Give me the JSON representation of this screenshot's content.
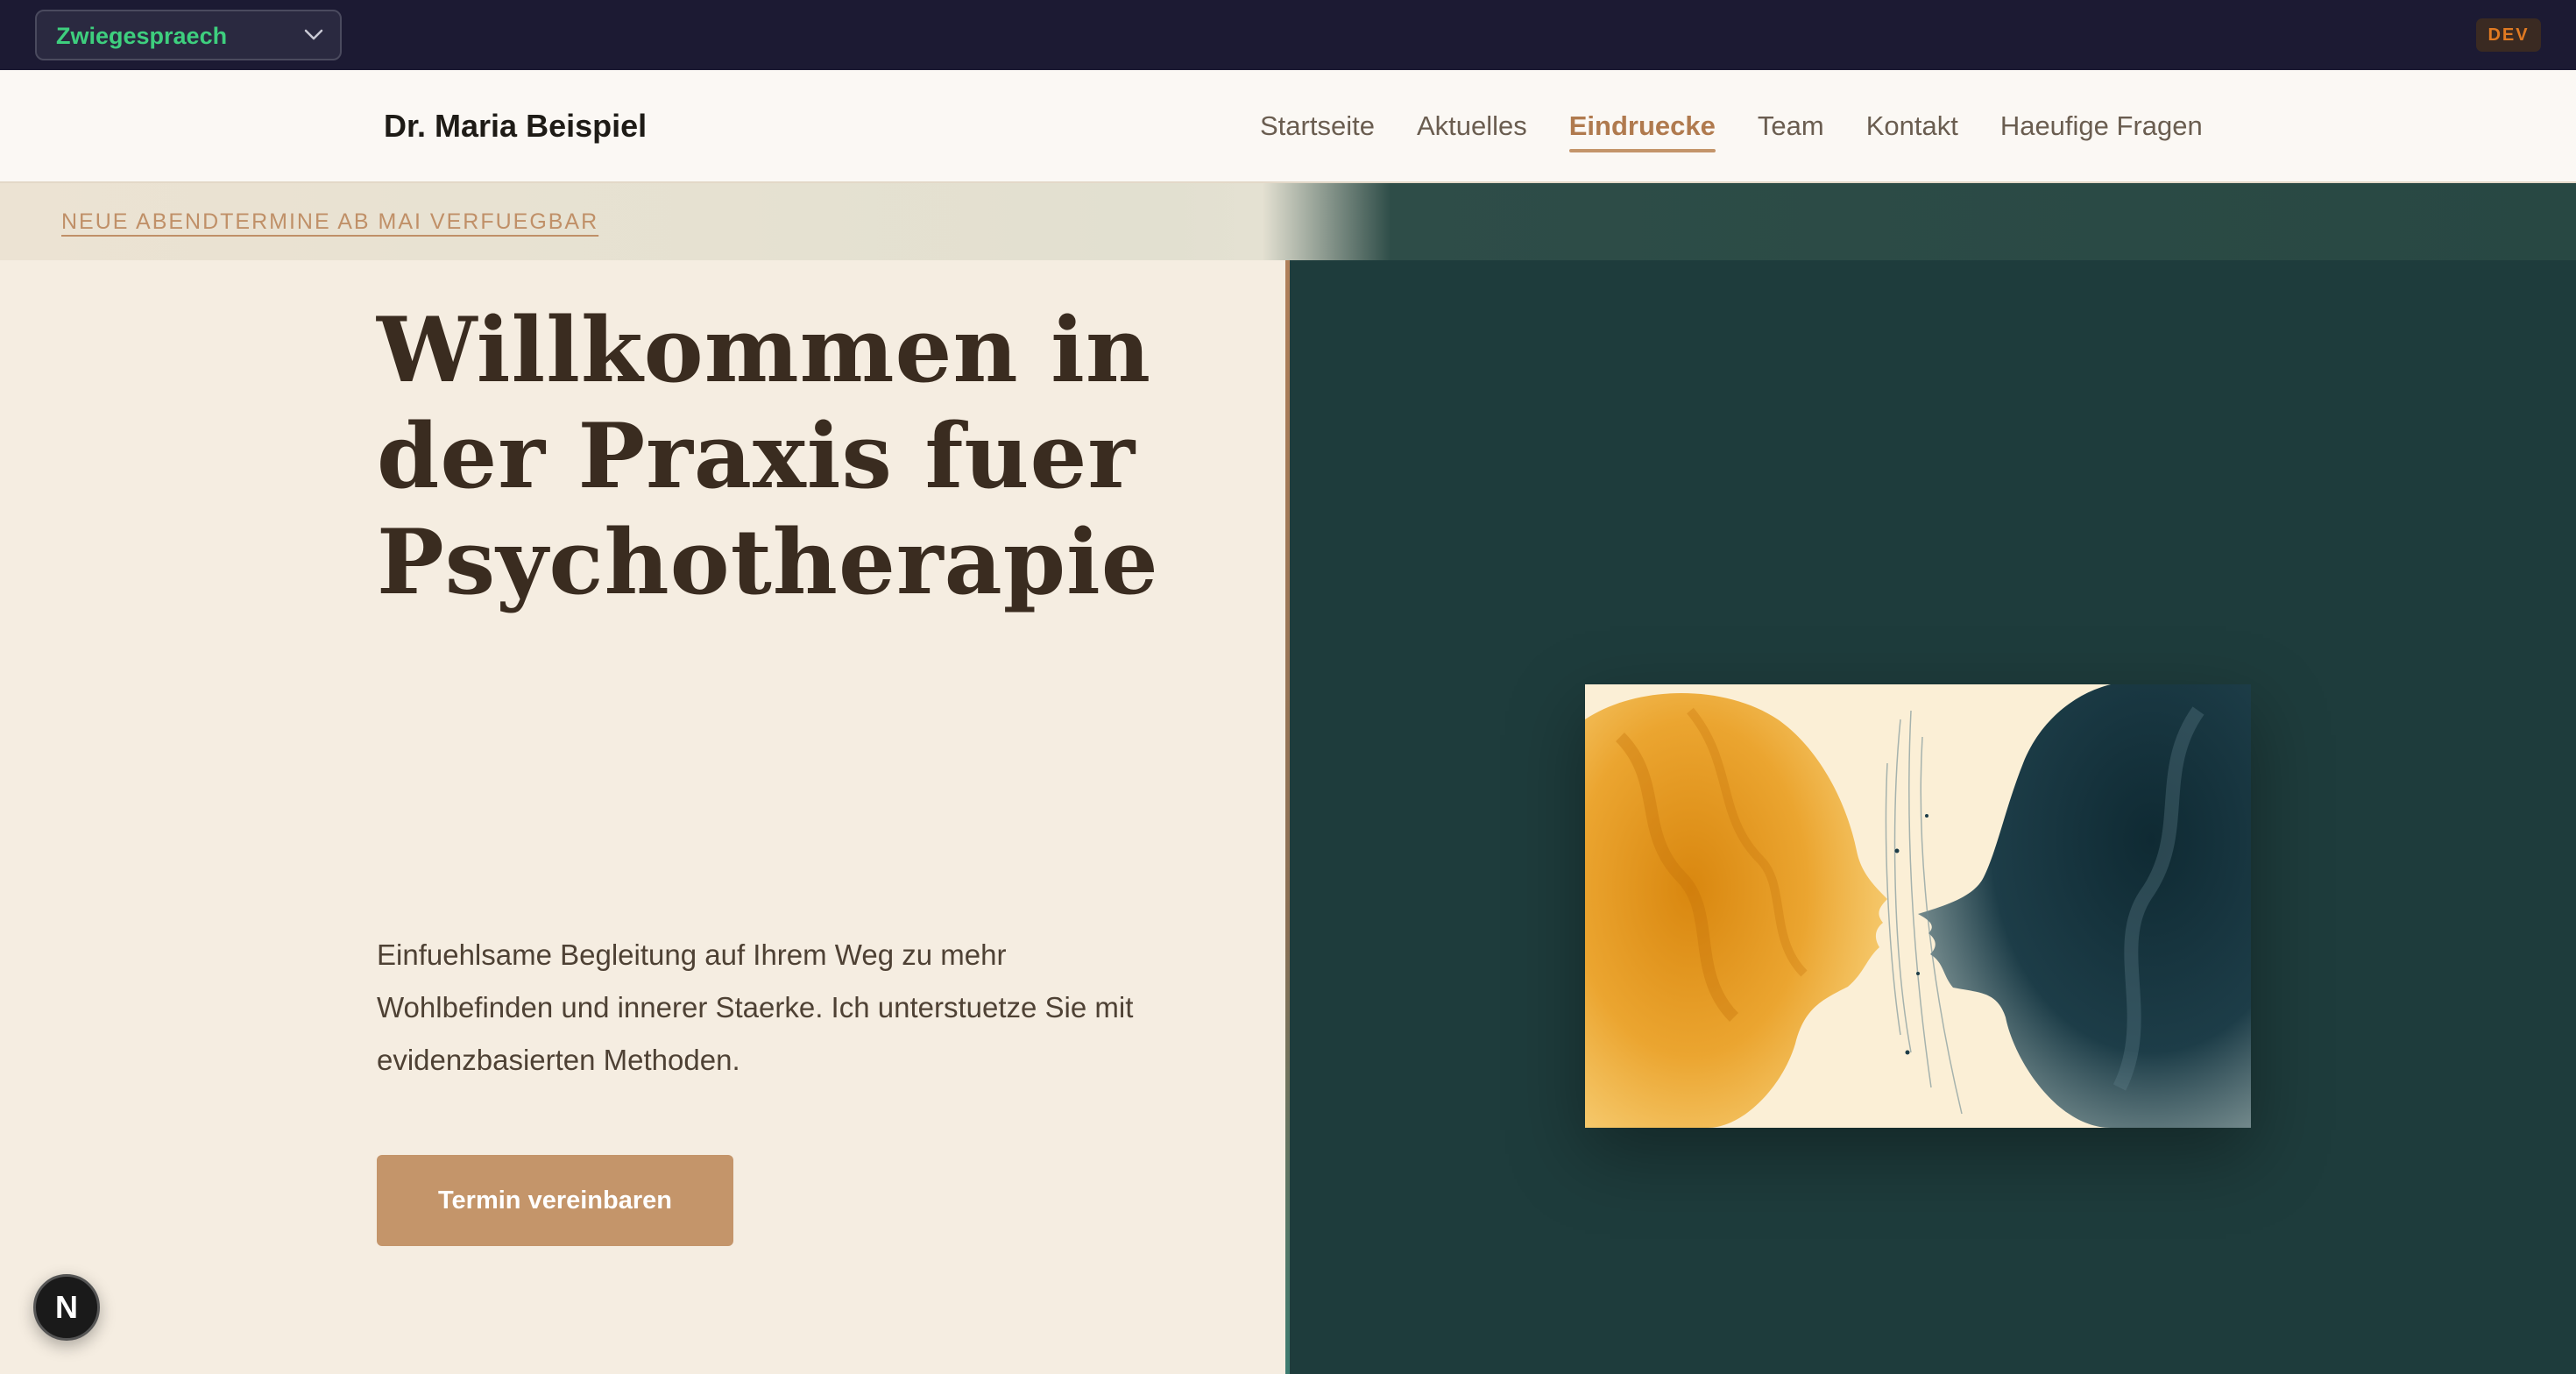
{
  "dev_toolbar": {
    "variant_label": "Zwiegespraech",
    "badge": "DEV",
    "badge_color": "#e07a22",
    "variant_color": "#3ecf7e"
  },
  "header": {
    "site_title": "Dr. Maria Beispiel",
    "nav": [
      {
        "label": "Startseite",
        "active": false
      },
      {
        "label": "Aktuelles",
        "active": false
      },
      {
        "label": "Eindruecke",
        "active": true
      },
      {
        "label": "Team",
        "active": false
      },
      {
        "label": "Kontakt",
        "active": false
      },
      {
        "label": "Haeufige Fragen",
        "active": false
      }
    ]
  },
  "announcement": {
    "text": "NEUE ABENDTERMINE AB MAI VERFUEGBAR"
  },
  "hero": {
    "headline_lines": [
      "Willkommen in",
      "der Praxis fuer",
      "Psychotherapie"
    ],
    "lead": "Einfuehlsame Begleitung auf Ihrem Weg zu mehr Wohlbefinden und innerer Staerke. Ich unterstuetze Sie mit evidenzbasierten Methoden.",
    "cta_label": "Termin vereinbaren",
    "image_icon": "two-faces-watercolor-illustration"
  },
  "floating": {
    "next_badge_label": "N",
    "icon": "nextjs-logo-icon"
  },
  "colors": {
    "accent": "#c4956a",
    "dark_panel": "#1e3c3c",
    "cream": "#f5ede1",
    "devbar": "#1c1a33"
  }
}
